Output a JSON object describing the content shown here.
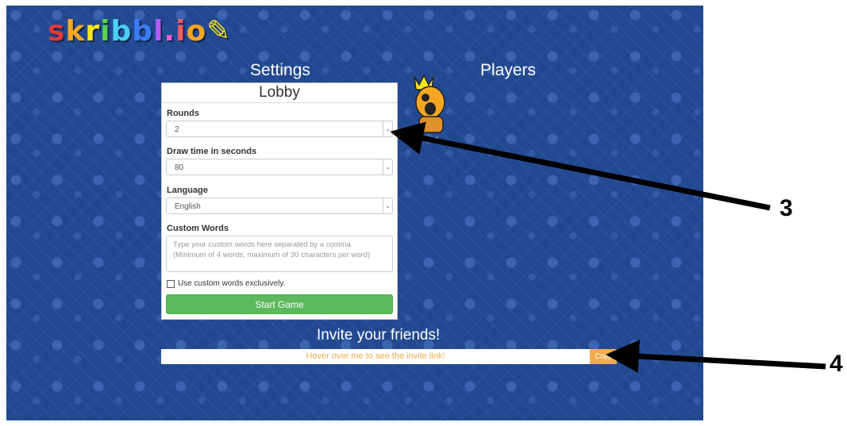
{
  "logo": {
    "text": "skribbl.io"
  },
  "headings": {
    "settings": "Settings",
    "players": "Players"
  },
  "lobby": {
    "title": "Lobby",
    "rounds_label": "Rounds",
    "rounds_value": "2",
    "drawtime_label": "Draw time in seconds",
    "drawtime_value": "80",
    "language_label": "Language",
    "language_value": "English",
    "custom_words_label": "Custom Words",
    "custom_words_placeholder": "Type your custom words here separated by a comma. (Minimum of 4 words, maximum of 30 characters per word)",
    "custom_exclusive_label": "Use custom words exclusively.",
    "start_button": "Start Game"
  },
  "players": [
    {
      "name": "pawii",
      "is_owner": true
    }
  ],
  "invite": {
    "title": "Invite your friends!",
    "link_text": "Hover over me to see the invite link!",
    "copy_button": "Copy"
  },
  "annotations": {
    "arrow_3": "3",
    "arrow_4": "4"
  },
  "colors": {
    "background": "#22498f",
    "start_button": "#5cb85c",
    "invite_accent": "#f0ad4e"
  }
}
